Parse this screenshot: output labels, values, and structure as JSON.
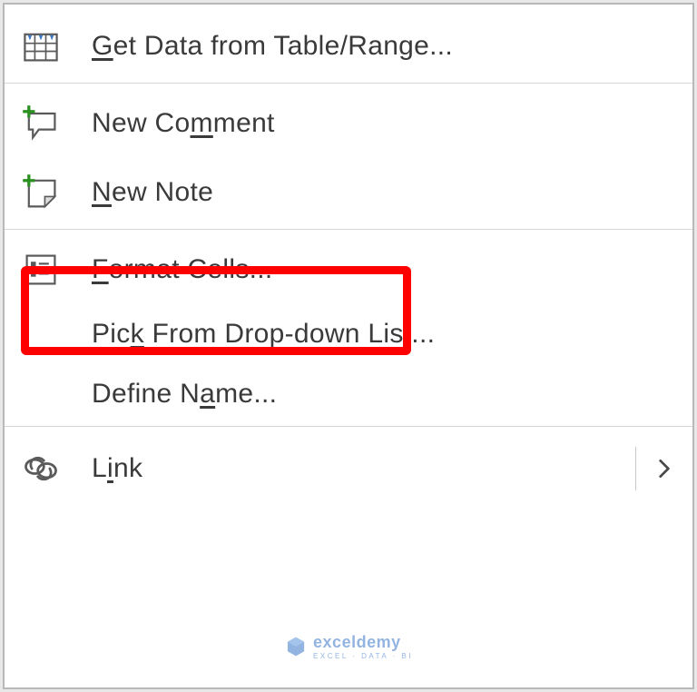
{
  "menu": {
    "items": [
      {
        "prefix": "",
        "accel": "G",
        "suffix": "et Data from Table/Range..."
      },
      {
        "prefix": "New Co",
        "accel": "m",
        "suffix": "ment"
      },
      {
        "prefix": "",
        "accel": "N",
        "suffix": "ew Note"
      },
      {
        "prefix": "",
        "accel": "F",
        "suffix": "ormat Cells..."
      },
      {
        "prefix": "Pic",
        "accel": "k",
        "suffix": " From Drop-down List..."
      },
      {
        "prefix": "Define N",
        "accel": "a",
        "suffix": "me..."
      },
      {
        "prefix": "L",
        "accel": "i",
        "suffix": "nk"
      }
    ]
  },
  "watermark": {
    "main": "exceldemy",
    "sub": "EXCEL · DATA · BI"
  }
}
